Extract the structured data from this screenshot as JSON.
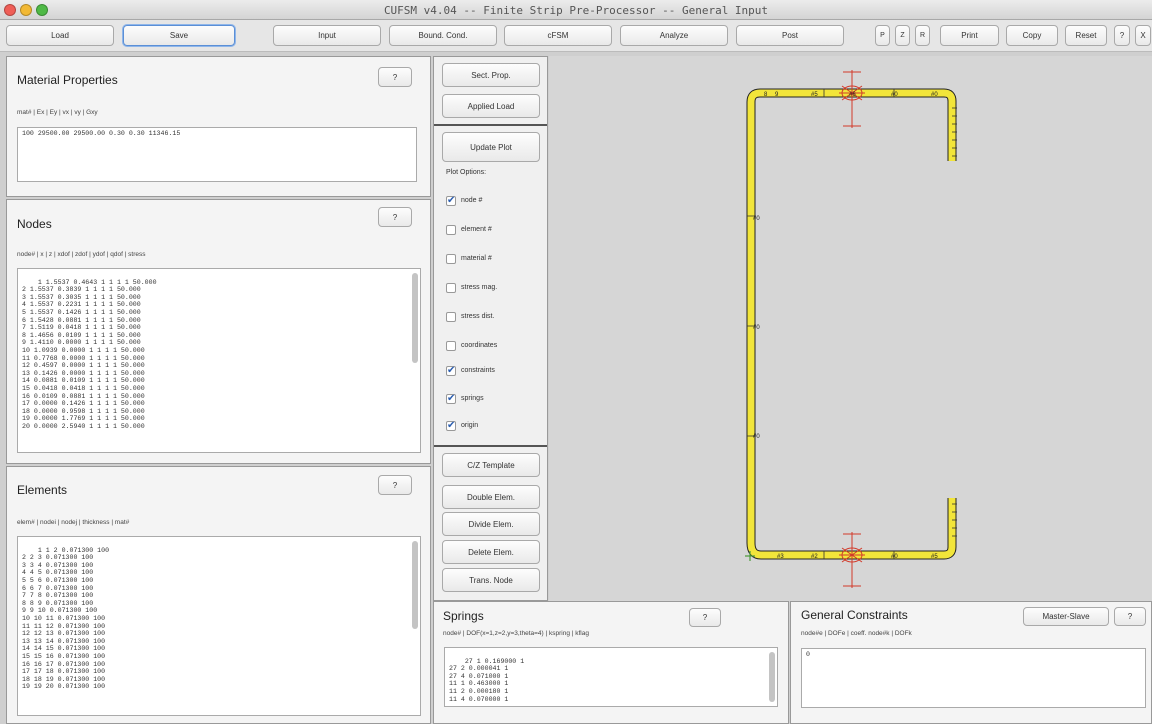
{
  "window": {
    "title": "CUFSM v4.04 -- Finite Strip Pre-Processor -- General Input"
  },
  "toolbar": {
    "load": "Load",
    "save": "Save",
    "input": "Input",
    "bound": "Bound. Cond.",
    "cfsm": "cFSM",
    "analyze": "Analyze",
    "post": "Post",
    "p": "P",
    "z": "Z",
    "r": "R",
    "print": "Print",
    "copy": "Copy",
    "reset": "Reset",
    "help": "?",
    "close": "X"
  },
  "material": {
    "title": "Material Properties",
    "help": "?",
    "header": "mat# | Ex | Ey | vx | vy | Gxy",
    "text": "100 29500.00 29500.00 0.30 0.30 11346.15"
  },
  "nodes": {
    "title": "Nodes",
    "help": "?",
    "header": "node# | x | z | xdof | zdof | ydof | qdof | stress",
    "text": "1 1.5537 0.4643 1 1 1 1 50.000\n2 1.5537 0.3839 1 1 1 1 50.000\n3 1.5537 0.3035 1 1 1 1 50.000\n4 1.5537 0.2231 1 1 1 1 50.000\n5 1.5537 0.1426 1 1 1 1 50.000\n6 1.5428 0.0881 1 1 1 1 50.000\n7 1.5119 0.0418 1 1 1 1 50.000\n8 1.4656 0.0109 1 1 1 1 50.000\n9 1.4110 0.0000 1 1 1 1 50.000\n10 1.0939 0.0000 1 1 1 1 50.000\n11 0.7768 0.0000 1 1 1 1 50.000\n12 0.4597 0.0000 1 1 1 1 50.000\n13 0.1426 0.0000 1 1 1 1 50.000\n14 0.0881 0.0109 1 1 1 1 50.000\n15 0.0418 0.0418 1 1 1 1 50.000\n16 0.0109 0.0881 1 1 1 1 50.000\n17 0.0000 0.1426 1 1 1 1 50.000\n18 0.0000 0.9598 1 1 1 1 50.000\n19 0.0000 1.7769 1 1 1 1 50.000\n20 0.0000 2.5940 1 1 1 1 50.000"
  },
  "elements": {
    "title": "Elements",
    "help": "?",
    "header": "elem# | nodei | nodej | thickness | mat#",
    "text": "1 1 2 0.071300 100\n2 2 3 0.071300 100\n3 3 4 0.071300 100\n4 4 5 0.071300 100\n5 5 6 0.071300 100\n6 6 7 0.071300 100\n7 7 8 0.071300 100\n8 8 9 0.071300 100\n9 9 10 0.071300 100\n10 10 11 0.071300 100\n11 11 12 0.071300 100\n12 12 13 0.071300 100\n13 13 14 0.071300 100\n14 14 15 0.071300 100\n15 15 16 0.071300 100\n16 16 17 0.071300 100\n17 17 18 0.071300 100\n18 18 19 0.071300 100\n19 19 20 0.071300 100"
  },
  "controls": {
    "sect_prop": "Sect. Prop.",
    "applied_load": "Applied Load",
    "update_plot": "Update Plot",
    "plot_options": "Plot Options:",
    "options": [
      {
        "label": "node #",
        "checked": true
      },
      {
        "label": "element #",
        "checked": false
      },
      {
        "label": "material #",
        "checked": false
      },
      {
        "label": "stress mag.",
        "checked": false
      },
      {
        "label": "stress dist.",
        "checked": false
      },
      {
        "label": "coordinates",
        "checked": false
      },
      {
        "label": "constraints",
        "checked": true
      },
      {
        "label": "springs",
        "checked": true
      },
      {
        "label": "origin",
        "checked": true
      }
    ],
    "cz_template": "C/Z Template",
    "double_elem": "Double Elem.",
    "divide_elem": "Divide Elem.",
    "delete_elem": "Delete Elem.",
    "trans_node": "Trans. Node",
    "check": "✔"
  },
  "springs": {
    "title": "Springs",
    "help": "?",
    "header": "node# | DOF(x=1,z=2,y=3,theta=4) | kspring | kflag",
    "text": "27 1 0.169000 1\n27 2 0.000041 1\n27 4 0.071000 1\n11 1 0.463000 1\n11 2 0.000180 1\n11 4 0.070000 1"
  },
  "constraints": {
    "title": "General Constraints",
    "master_slave": "Master-Slave",
    "help": "?",
    "header": "node#e | DOFe | coeff. node#k | DOFk",
    "text": "0"
  },
  "plot": {
    "section_color": "#f2e53a",
    "outline_color": "#222222",
    "constraint_color": "#d23a2a",
    "labels": {
      "top_flange": [
        "8",
        "9",
        "#5",
        "#6",
        "#0",
        "#0"
      ],
      "web": [
        "#0",
        "#0",
        "#0"
      ],
      "bottom_flange": [
        "#3",
        "#2",
        "#0",
        "#5"
      ]
    }
  }
}
